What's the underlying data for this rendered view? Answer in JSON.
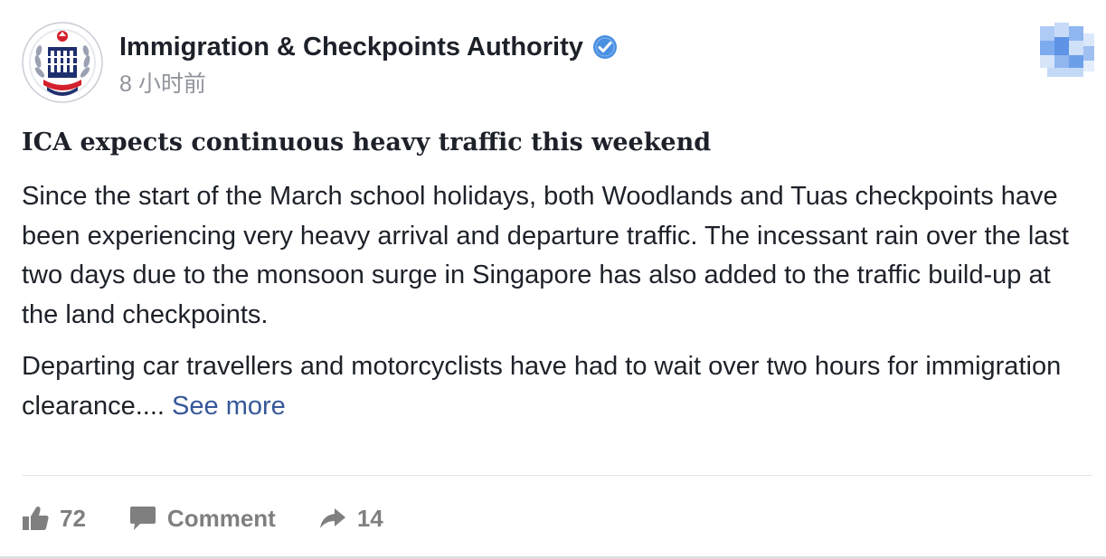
{
  "post": {
    "author": {
      "name": "Immigration & Checkpoints Authority",
      "verified": true,
      "avatar_icon": "ica-crest-logo"
    },
    "timestamp": "8 小时前",
    "headline": "ICA expects continuous heavy traffic this weekend",
    "paragraphs": [
      "Since the start of the March school holidays, both Woodlands and Tuas checkpoints have been experiencing very heavy arrival and departure traffic. The incessant rain over the last two days due to the monsoon surge in Singapore has also added to the traffic build-up at the land checkpoints.",
      "Departing car travellers and motorcyclists have had to wait over two hours for immigration clearance...."
    ],
    "see_more_label": "See more",
    "actions": {
      "like_count": "72",
      "comment_label": "Comment",
      "share_count": "14"
    }
  },
  "colors": {
    "text": "#1d2129",
    "meta": "#90949c",
    "link": "#365899",
    "action": "#7f7f7f",
    "verified_badge": "#4a90e2",
    "crest_red": "#d4202c",
    "crest_navy": "#1f2f6e"
  }
}
